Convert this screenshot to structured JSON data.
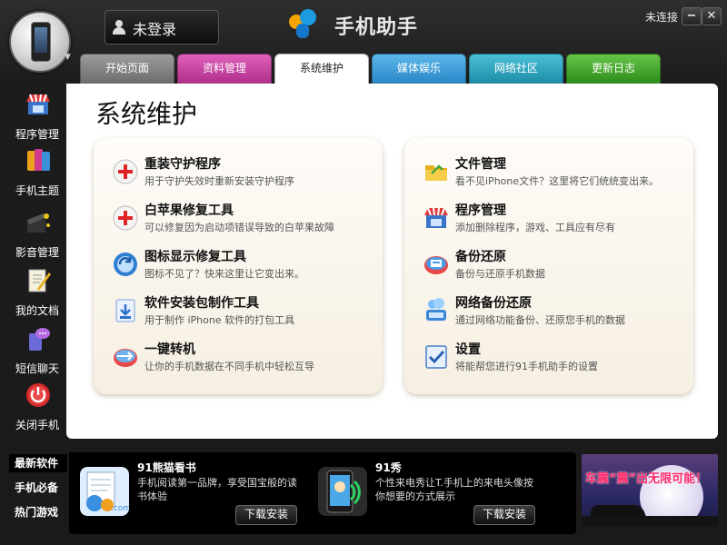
{
  "header": {
    "login_text": "未登录",
    "app_name": "手机助手",
    "connection_status": "未连接",
    "min_glyph": "−",
    "close_glyph": "✕"
  },
  "tabs": [
    {
      "label": "开始页面",
      "color": "#8a8a8a",
      "active": false
    },
    {
      "label": "资料管理",
      "color": "#d04da8",
      "active": false
    },
    {
      "label": "系统维护",
      "color": "#ffffff",
      "active": true
    },
    {
      "label": "媒体娱乐",
      "color": "#3f9fd8",
      "active": false
    },
    {
      "label": "网络社区",
      "color": "#2fa7c2",
      "active": false
    },
    {
      "label": "更新日志",
      "color": "#44aa2a",
      "active": false
    }
  ],
  "sidebar": {
    "items": [
      {
        "label": "程序管理",
        "icon": "store-icon"
      },
      {
        "label": "手机主题",
        "icon": "theme-icon"
      },
      {
        "label": "影音管理",
        "icon": "media-icon"
      },
      {
        "label": "我的文档",
        "icon": "document-icon"
      },
      {
        "label": "短信聊天",
        "icon": "sms-icon"
      },
      {
        "label": "关闭手机",
        "icon": "power-icon"
      }
    ]
  },
  "main": {
    "title": "系统维护",
    "left_entries": [
      {
        "title": "重装守护程序",
        "desc": "用于守护失效时重新安装守护程序",
        "icon": "red-cross-icon"
      },
      {
        "title": "白苹果修复工具",
        "desc": "可以修复因为启动项错误导致的白苹果故障",
        "icon": "red-cross-icon"
      },
      {
        "title": "图标显示修复工具",
        "desc": "图标不见了？快来这里让它变出来。",
        "icon": "refresh-icon"
      },
      {
        "title": "软件安装包制作工具",
        "desc": "用于制作 iPhone 软件的打包工具",
        "icon": "package-icon"
      },
      {
        "title": "一键转机",
        "desc": "让你的手机数据在不同手机中轻松互导",
        "icon": "transfer-icon"
      }
    ],
    "right_entries": [
      {
        "title": "文件管理",
        "desc": "看不见iPhone文件？这里将它们统统变出来。",
        "icon": "folder-icon"
      },
      {
        "title": "程序管理",
        "desc": "添加删除程序，游戏、工具应有尽有",
        "icon": "store-icon"
      },
      {
        "title": "备份还原",
        "desc": "备份与还原手机数据",
        "icon": "backup-icon"
      },
      {
        "title": "网络备份还原",
        "desc": "通过网络功能备份、还原您手机的数据",
        "icon": "network-backup-icon"
      },
      {
        "title": "设置",
        "desc": "将能帮您进行91手机助手的设置",
        "icon": "settings-icon"
      }
    ]
  },
  "bottom": {
    "tabs": [
      "最新软件",
      "手机必备",
      "热门游戏"
    ],
    "apps": [
      {
        "name": "91熊猫看书",
        "desc": "手机阅读第一品牌，享受国宝般的读书体验",
        "button": "下载安装",
        "icon": "panda-book-icon"
      },
      {
        "name": "91秀",
        "desc": "个性来电秀让T.手机上的来电头像按你想要的方式展示",
        "button": "下载安装",
        "icon": "call-show-icon"
      }
    ],
    "banner_text": "车震“震”出无限可能！"
  }
}
